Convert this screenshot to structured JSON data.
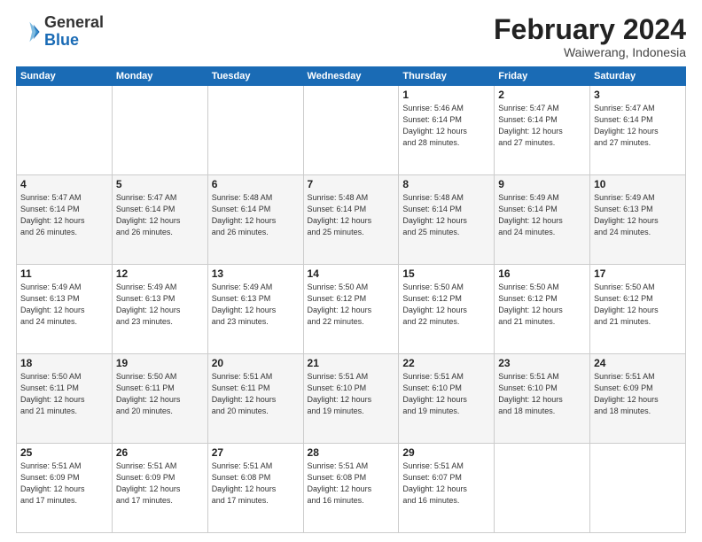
{
  "logo": {
    "general": "General",
    "blue": "Blue"
  },
  "title": {
    "month": "February 2024",
    "location": "Waiwerang, Indonesia"
  },
  "days_of_week": [
    "Sunday",
    "Monday",
    "Tuesday",
    "Wednesday",
    "Thursday",
    "Friday",
    "Saturday"
  ],
  "weeks": [
    [
      {
        "day": "",
        "info": ""
      },
      {
        "day": "",
        "info": ""
      },
      {
        "day": "",
        "info": ""
      },
      {
        "day": "",
        "info": ""
      },
      {
        "day": "1",
        "info": "Sunrise: 5:46 AM\nSunset: 6:14 PM\nDaylight: 12 hours\nand 28 minutes."
      },
      {
        "day": "2",
        "info": "Sunrise: 5:47 AM\nSunset: 6:14 PM\nDaylight: 12 hours\nand 27 minutes."
      },
      {
        "day": "3",
        "info": "Sunrise: 5:47 AM\nSunset: 6:14 PM\nDaylight: 12 hours\nand 27 minutes."
      }
    ],
    [
      {
        "day": "4",
        "info": "Sunrise: 5:47 AM\nSunset: 6:14 PM\nDaylight: 12 hours\nand 26 minutes."
      },
      {
        "day": "5",
        "info": "Sunrise: 5:47 AM\nSunset: 6:14 PM\nDaylight: 12 hours\nand 26 minutes."
      },
      {
        "day": "6",
        "info": "Sunrise: 5:48 AM\nSunset: 6:14 PM\nDaylight: 12 hours\nand 26 minutes."
      },
      {
        "day": "7",
        "info": "Sunrise: 5:48 AM\nSunset: 6:14 PM\nDaylight: 12 hours\nand 25 minutes."
      },
      {
        "day": "8",
        "info": "Sunrise: 5:48 AM\nSunset: 6:14 PM\nDaylight: 12 hours\nand 25 minutes."
      },
      {
        "day": "9",
        "info": "Sunrise: 5:49 AM\nSunset: 6:14 PM\nDaylight: 12 hours\nand 24 minutes."
      },
      {
        "day": "10",
        "info": "Sunrise: 5:49 AM\nSunset: 6:13 PM\nDaylight: 12 hours\nand 24 minutes."
      }
    ],
    [
      {
        "day": "11",
        "info": "Sunrise: 5:49 AM\nSunset: 6:13 PM\nDaylight: 12 hours\nand 24 minutes."
      },
      {
        "day": "12",
        "info": "Sunrise: 5:49 AM\nSunset: 6:13 PM\nDaylight: 12 hours\nand 23 minutes."
      },
      {
        "day": "13",
        "info": "Sunrise: 5:49 AM\nSunset: 6:13 PM\nDaylight: 12 hours\nand 23 minutes."
      },
      {
        "day": "14",
        "info": "Sunrise: 5:50 AM\nSunset: 6:12 PM\nDaylight: 12 hours\nand 22 minutes."
      },
      {
        "day": "15",
        "info": "Sunrise: 5:50 AM\nSunset: 6:12 PM\nDaylight: 12 hours\nand 22 minutes."
      },
      {
        "day": "16",
        "info": "Sunrise: 5:50 AM\nSunset: 6:12 PM\nDaylight: 12 hours\nand 21 minutes."
      },
      {
        "day": "17",
        "info": "Sunrise: 5:50 AM\nSunset: 6:12 PM\nDaylight: 12 hours\nand 21 minutes."
      }
    ],
    [
      {
        "day": "18",
        "info": "Sunrise: 5:50 AM\nSunset: 6:11 PM\nDaylight: 12 hours\nand 21 minutes."
      },
      {
        "day": "19",
        "info": "Sunrise: 5:50 AM\nSunset: 6:11 PM\nDaylight: 12 hours\nand 20 minutes."
      },
      {
        "day": "20",
        "info": "Sunrise: 5:51 AM\nSunset: 6:11 PM\nDaylight: 12 hours\nand 20 minutes."
      },
      {
        "day": "21",
        "info": "Sunrise: 5:51 AM\nSunset: 6:10 PM\nDaylight: 12 hours\nand 19 minutes."
      },
      {
        "day": "22",
        "info": "Sunrise: 5:51 AM\nSunset: 6:10 PM\nDaylight: 12 hours\nand 19 minutes."
      },
      {
        "day": "23",
        "info": "Sunrise: 5:51 AM\nSunset: 6:10 PM\nDaylight: 12 hours\nand 18 minutes."
      },
      {
        "day": "24",
        "info": "Sunrise: 5:51 AM\nSunset: 6:09 PM\nDaylight: 12 hours\nand 18 minutes."
      }
    ],
    [
      {
        "day": "25",
        "info": "Sunrise: 5:51 AM\nSunset: 6:09 PM\nDaylight: 12 hours\nand 17 minutes."
      },
      {
        "day": "26",
        "info": "Sunrise: 5:51 AM\nSunset: 6:09 PM\nDaylight: 12 hours\nand 17 minutes."
      },
      {
        "day": "27",
        "info": "Sunrise: 5:51 AM\nSunset: 6:08 PM\nDaylight: 12 hours\nand 17 minutes."
      },
      {
        "day": "28",
        "info": "Sunrise: 5:51 AM\nSunset: 6:08 PM\nDaylight: 12 hours\nand 16 minutes."
      },
      {
        "day": "29",
        "info": "Sunrise: 5:51 AM\nSunset: 6:07 PM\nDaylight: 12 hours\nand 16 minutes."
      },
      {
        "day": "",
        "info": ""
      },
      {
        "day": "",
        "info": ""
      }
    ]
  ]
}
